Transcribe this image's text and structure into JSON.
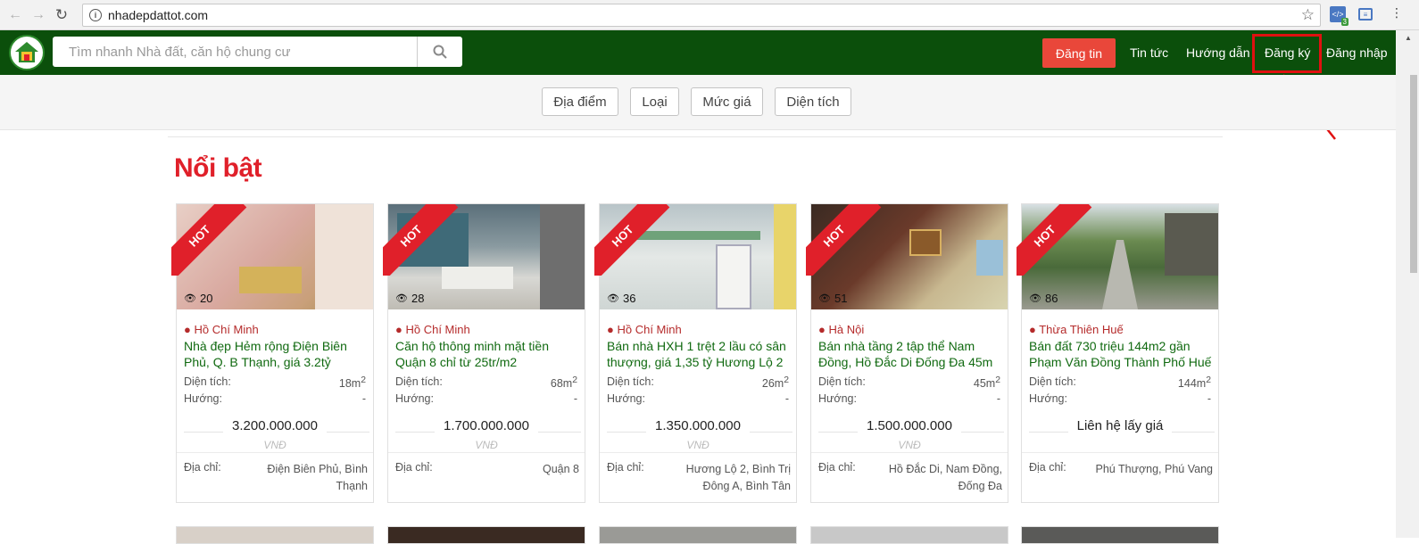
{
  "browser": {
    "url": "nhadepdattot.com",
    "ext_badge": "3"
  },
  "header": {
    "search_placeholder": "Tìm nhanh Nhà đất, căn hộ chung cư",
    "post_label": "Đăng tin",
    "nav": {
      "news": "Tin tức",
      "guide": "Hướng dẫn",
      "register": "Đăng ký",
      "login": "Đăng nhập"
    }
  },
  "filters": [
    "Địa điểm",
    "Loại",
    "Mức giá",
    "Diện tích"
  ],
  "section_title": "Nổi bật",
  "labels": {
    "hot": "HOT",
    "area": "Diện tích:",
    "direction": "Hướng:",
    "currency": "VNĐ",
    "address": "Địa chỉ:"
  },
  "listings": [
    {
      "views": "20",
      "location": "Hồ Chí Minh",
      "title": "Nhà đẹp Hẻm rộng Điện Biên Phủ, Q. B Thạnh, giá 3.2tỷ",
      "area": "18m2",
      "direction": "-",
      "price": "3.200.000.000",
      "address": "Điện Biên Phủ, Bình Thạnh"
    },
    {
      "views": "28",
      "location": "Hồ Chí Minh",
      "title": "Căn hộ thông minh mặt tiền Quận 8 chỉ từ 25tr/m2",
      "area": "68m2",
      "direction": "-",
      "price": "1.700.000.000",
      "address": "Quận 8"
    },
    {
      "views": "36",
      "location": "Hồ Chí Minh",
      "title": "Bán nhà HXH 1 trệt 2 lầu có sân thượng, giá 1,35 tỷ Hương Lộ 2",
      "area": "26m2",
      "direction": "-",
      "price": "1.350.000.000",
      "address": "Hương Lộ 2, Bình Trị Đông A, Bình Tân"
    },
    {
      "views": "51",
      "location": "Hà Nội",
      "title": "Bán nhà tầng 2 tập thể Nam Đồng, Hồ Đắc Di Đống Đa 45m",
      "area": "45m2",
      "direction": "-",
      "price": "1.500.000.000",
      "address": "Hồ Đắc Di, Nam Đồng, Đống Đa"
    },
    {
      "views": "86",
      "location": "Thừa Thiên Huế",
      "title": "Bán đất 730 triệu 144m2 gần Phạm Văn Đồng Thành Phố Huế",
      "area": "144m2",
      "direction": "-",
      "price": "Liên hệ lấy giá",
      "address": "Phú Thượng, Phú Vang"
    }
  ]
}
